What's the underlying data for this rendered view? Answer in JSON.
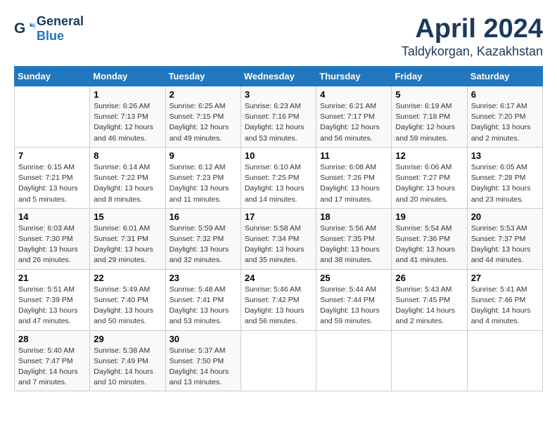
{
  "header": {
    "logo_general": "General",
    "logo_blue": "Blue",
    "month_title": "April 2024",
    "location": "Taldykorgan, Kazakhstan"
  },
  "calendar": {
    "headers": [
      "Sunday",
      "Monday",
      "Tuesday",
      "Wednesday",
      "Thursday",
      "Friday",
      "Saturday"
    ],
    "weeks": [
      [
        {
          "day": "",
          "sunrise": "",
          "sunset": "",
          "daylight": ""
        },
        {
          "day": "1",
          "sunrise": "Sunrise: 6:26 AM",
          "sunset": "Sunset: 7:13 PM",
          "daylight": "Daylight: 12 hours and 46 minutes."
        },
        {
          "day": "2",
          "sunrise": "Sunrise: 6:25 AM",
          "sunset": "Sunset: 7:15 PM",
          "daylight": "Daylight: 12 hours and 49 minutes."
        },
        {
          "day": "3",
          "sunrise": "Sunrise: 6:23 AM",
          "sunset": "Sunset: 7:16 PM",
          "daylight": "Daylight: 12 hours and 53 minutes."
        },
        {
          "day": "4",
          "sunrise": "Sunrise: 6:21 AM",
          "sunset": "Sunset: 7:17 PM",
          "daylight": "Daylight: 12 hours and 56 minutes."
        },
        {
          "day": "5",
          "sunrise": "Sunrise: 6:19 AM",
          "sunset": "Sunset: 7:18 PM",
          "daylight": "Daylight: 12 hours and 59 minutes."
        },
        {
          "day": "6",
          "sunrise": "Sunrise: 6:17 AM",
          "sunset": "Sunset: 7:20 PM",
          "daylight": "Daylight: 13 hours and 2 minutes."
        }
      ],
      [
        {
          "day": "7",
          "sunrise": "Sunrise: 6:15 AM",
          "sunset": "Sunset: 7:21 PM",
          "daylight": "Daylight: 13 hours and 5 minutes."
        },
        {
          "day": "8",
          "sunrise": "Sunrise: 6:14 AM",
          "sunset": "Sunset: 7:22 PM",
          "daylight": "Daylight: 13 hours and 8 minutes."
        },
        {
          "day": "9",
          "sunrise": "Sunrise: 6:12 AM",
          "sunset": "Sunset: 7:23 PM",
          "daylight": "Daylight: 13 hours and 11 minutes."
        },
        {
          "day": "10",
          "sunrise": "Sunrise: 6:10 AM",
          "sunset": "Sunset: 7:25 PM",
          "daylight": "Daylight: 13 hours and 14 minutes."
        },
        {
          "day": "11",
          "sunrise": "Sunrise: 6:08 AM",
          "sunset": "Sunset: 7:26 PM",
          "daylight": "Daylight: 13 hours and 17 minutes."
        },
        {
          "day": "12",
          "sunrise": "Sunrise: 6:06 AM",
          "sunset": "Sunset: 7:27 PM",
          "daylight": "Daylight: 13 hours and 20 minutes."
        },
        {
          "day": "13",
          "sunrise": "Sunrise: 6:05 AM",
          "sunset": "Sunset: 7:28 PM",
          "daylight": "Daylight: 13 hours and 23 minutes."
        }
      ],
      [
        {
          "day": "14",
          "sunrise": "Sunrise: 6:03 AM",
          "sunset": "Sunset: 7:30 PM",
          "daylight": "Daylight: 13 hours and 26 minutes."
        },
        {
          "day": "15",
          "sunrise": "Sunrise: 6:01 AM",
          "sunset": "Sunset: 7:31 PM",
          "daylight": "Daylight: 13 hours and 29 minutes."
        },
        {
          "day": "16",
          "sunrise": "Sunrise: 5:59 AM",
          "sunset": "Sunset: 7:32 PM",
          "daylight": "Daylight: 13 hours and 32 minutes."
        },
        {
          "day": "17",
          "sunrise": "Sunrise: 5:58 AM",
          "sunset": "Sunset: 7:34 PM",
          "daylight": "Daylight: 13 hours and 35 minutes."
        },
        {
          "day": "18",
          "sunrise": "Sunrise: 5:56 AM",
          "sunset": "Sunset: 7:35 PM",
          "daylight": "Daylight: 13 hours and 38 minutes."
        },
        {
          "day": "19",
          "sunrise": "Sunrise: 5:54 AM",
          "sunset": "Sunset: 7:36 PM",
          "daylight": "Daylight: 13 hours and 41 minutes."
        },
        {
          "day": "20",
          "sunrise": "Sunrise: 5:53 AM",
          "sunset": "Sunset: 7:37 PM",
          "daylight": "Daylight: 13 hours and 44 minutes."
        }
      ],
      [
        {
          "day": "21",
          "sunrise": "Sunrise: 5:51 AM",
          "sunset": "Sunset: 7:39 PM",
          "daylight": "Daylight: 13 hours and 47 minutes."
        },
        {
          "day": "22",
          "sunrise": "Sunrise: 5:49 AM",
          "sunset": "Sunset: 7:40 PM",
          "daylight": "Daylight: 13 hours and 50 minutes."
        },
        {
          "day": "23",
          "sunrise": "Sunrise: 5:48 AM",
          "sunset": "Sunset: 7:41 PM",
          "daylight": "Daylight: 13 hours and 53 minutes."
        },
        {
          "day": "24",
          "sunrise": "Sunrise: 5:46 AM",
          "sunset": "Sunset: 7:42 PM",
          "daylight": "Daylight: 13 hours and 56 minutes."
        },
        {
          "day": "25",
          "sunrise": "Sunrise: 5:44 AM",
          "sunset": "Sunset: 7:44 PM",
          "daylight": "Daylight: 13 hours and 59 minutes."
        },
        {
          "day": "26",
          "sunrise": "Sunrise: 5:43 AM",
          "sunset": "Sunset: 7:45 PM",
          "daylight": "Daylight: 14 hours and 2 minutes."
        },
        {
          "day": "27",
          "sunrise": "Sunrise: 5:41 AM",
          "sunset": "Sunset: 7:46 PM",
          "daylight": "Daylight: 14 hours and 4 minutes."
        }
      ],
      [
        {
          "day": "28",
          "sunrise": "Sunrise: 5:40 AM",
          "sunset": "Sunset: 7:47 PM",
          "daylight": "Daylight: 14 hours and 7 minutes."
        },
        {
          "day": "29",
          "sunrise": "Sunrise: 5:38 AM",
          "sunset": "Sunset: 7:49 PM",
          "daylight": "Daylight: 14 hours and 10 minutes."
        },
        {
          "day": "30",
          "sunrise": "Sunrise: 5:37 AM",
          "sunset": "Sunset: 7:50 PM",
          "daylight": "Daylight: 14 hours and 13 minutes."
        },
        {
          "day": "",
          "sunrise": "",
          "sunset": "",
          "daylight": ""
        },
        {
          "day": "",
          "sunrise": "",
          "sunset": "",
          "daylight": ""
        },
        {
          "day": "",
          "sunrise": "",
          "sunset": "",
          "daylight": ""
        },
        {
          "day": "",
          "sunrise": "",
          "sunset": "",
          "daylight": ""
        }
      ]
    ]
  }
}
